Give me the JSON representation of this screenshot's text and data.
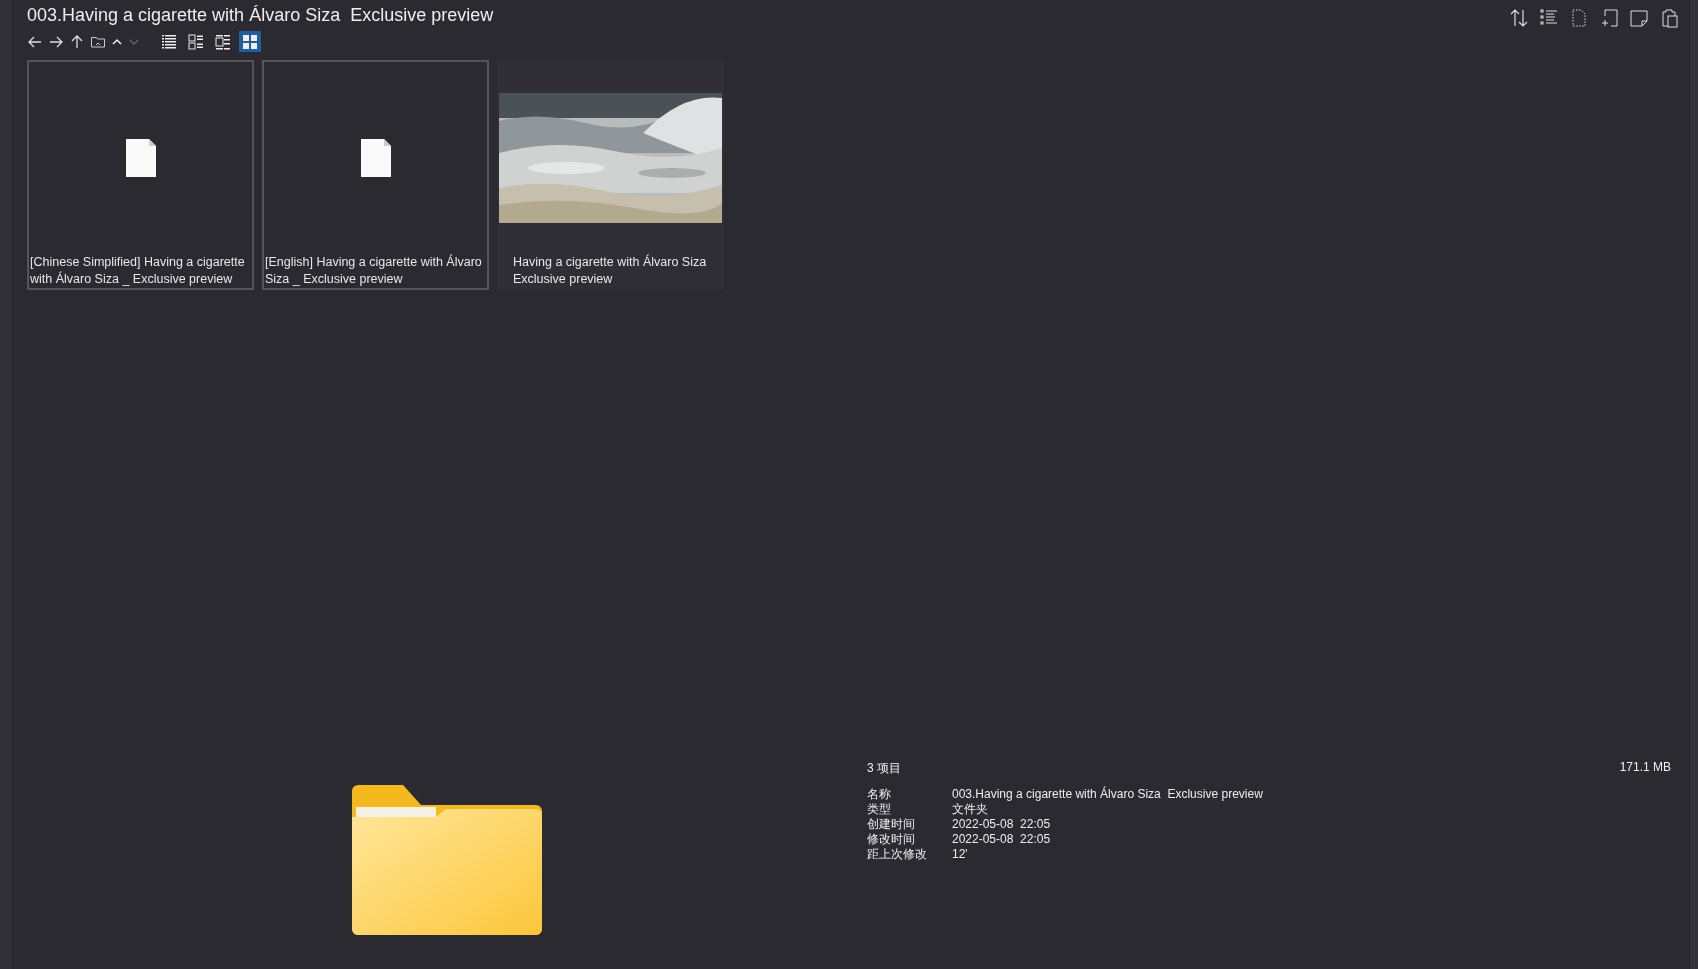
{
  "window": {
    "title": "003.Having a cigarette with Álvaro Siza  Exclusive preview"
  },
  "views": [
    {
      "selected": false
    },
    {
      "selected": false
    },
    {
      "selected": false
    },
    {
      "selected": true
    }
  ],
  "items": [
    {
      "kind": "document",
      "name": "[Chinese Simplified] Having a cigarette with Álvaro Siza _ Exclusive preview",
      "selected": true
    },
    {
      "kind": "document",
      "name": "[English] Having a cigarette with Álvaro Siza _ Exclusive preview",
      "selected": true
    },
    {
      "kind": "video",
      "name": "Having a cigarette with Álvaro Siza Exclusive preview",
      "selected": false
    }
  ],
  "details": {
    "count": "3 项目",
    "size": "171.1 MB",
    "properties": [
      {
        "label": "名称",
        "value": "003.Having a cigarette with Álvaro Siza  Exclusive preview"
      },
      {
        "label": "类型",
        "value": "文件夹"
      },
      {
        "label": "创建时间",
        "value": "2022-05-08  22:05"
      },
      {
        "label": "修改时间",
        "value": "2022-05-08  22:05"
      },
      {
        "label": "距上次修改",
        "value": "12'"
      }
    ]
  }
}
